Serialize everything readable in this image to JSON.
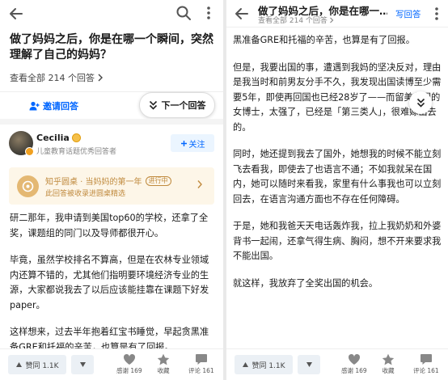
{
  "left": {
    "question_title": "做了妈妈之后，你是在哪一个瞬间，突然理解了自己的妈妈？",
    "view_all": "查看全部 214 个回答",
    "invite_label": "邀请回答",
    "next_label": "下一个回答",
    "author": {
      "name": "Cecilia",
      "info": "儿童教育话题优秀回答者",
      "follow_label": "关注"
    },
    "banner": {
      "title": "知乎圆桌 · 当妈妈的第一年",
      "badge": "进行中",
      "subtitle": "此回答被收录进圆桌精选"
    },
    "paragraphs": [
      "研二那年，我申请到美国top60的学校，还拿了全奖，课题组的同门以及导师都很开心。",
      "毕竟，虽然学校排名不算高，但是在农林专业领域内还算不错的，尤其他们指明要环境经济专业的生源，大家都说我去了以后应该能挂靠在课题下好发paper。",
      "这样想来，过去半年抱着红宝书睡觉，早起贪黑准备GRE和托福的辛苦，也算是有了回报。"
    ],
    "bottom": {
      "vote_label": "赞同 1.1K",
      "thanks": "感谢 169",
      "collect": "收藏",
      "comments": "评论 161"
    }
  },
  "right": {
    "header_title": "做了妈妈之后，你是在哪一…",
    "header_sub": "查看全部 214 个回答",
    "write_label": "写回答",
    "paragraphs": [
      "黑准备GRE和托福的辛苦，也算是有了回报。",
      "但是，我要出国的事，遭遇到我妈的坚决反对，理由是我当时和前男友分手不久，我发现出国读博至少需要5年，即使再回国也已经28岁了——而留美归国的女博士，太强了，已经是「第三类人」，很难嫁出去的。",
      "同时，她还提到我去了国外，她想我的时候不能立刻飞去看我，即使去了也语言不通；不如我就呆在国内，她可以随时来看我，家里有什么事我也可以立刻回去，在语言沟通方面也不存在任何障碍。",
      "于是，她和我爸天天电话轰炸我，拉上我奶奶和外婆背书一起闹，还拿气得生病、胸闷，想不开来要求我不能出国。",
      "就这样，我放弃了全奖出国的机会。"
    ],
    "bottom": {
      "vote_label": "赞同 1.1K",
      "thanks": "感谢 169",
      "collect": "收藏",
      "comments": "评论 161"
    }
  },
  "colors": {
    "accent": "#0066ff",
    "banner_bg": "#fdf6e8",
    "banner_text": "#c08a3e",
    "vote_bg": "#ebf0f5"
  },
  "icons": [
    "back-arrow-icon",
    "search-icon",
    "more-vertical-icon",
    "chevron-right-icon",
    "add-user-icon",
    "double-chevron-down-icon",
    "plus-icon",
    "triangle-up-icon",
    "triangle-down-icon",
    "heart-icon",
    "star-icon",
    "comment-icon"
  ]
}
